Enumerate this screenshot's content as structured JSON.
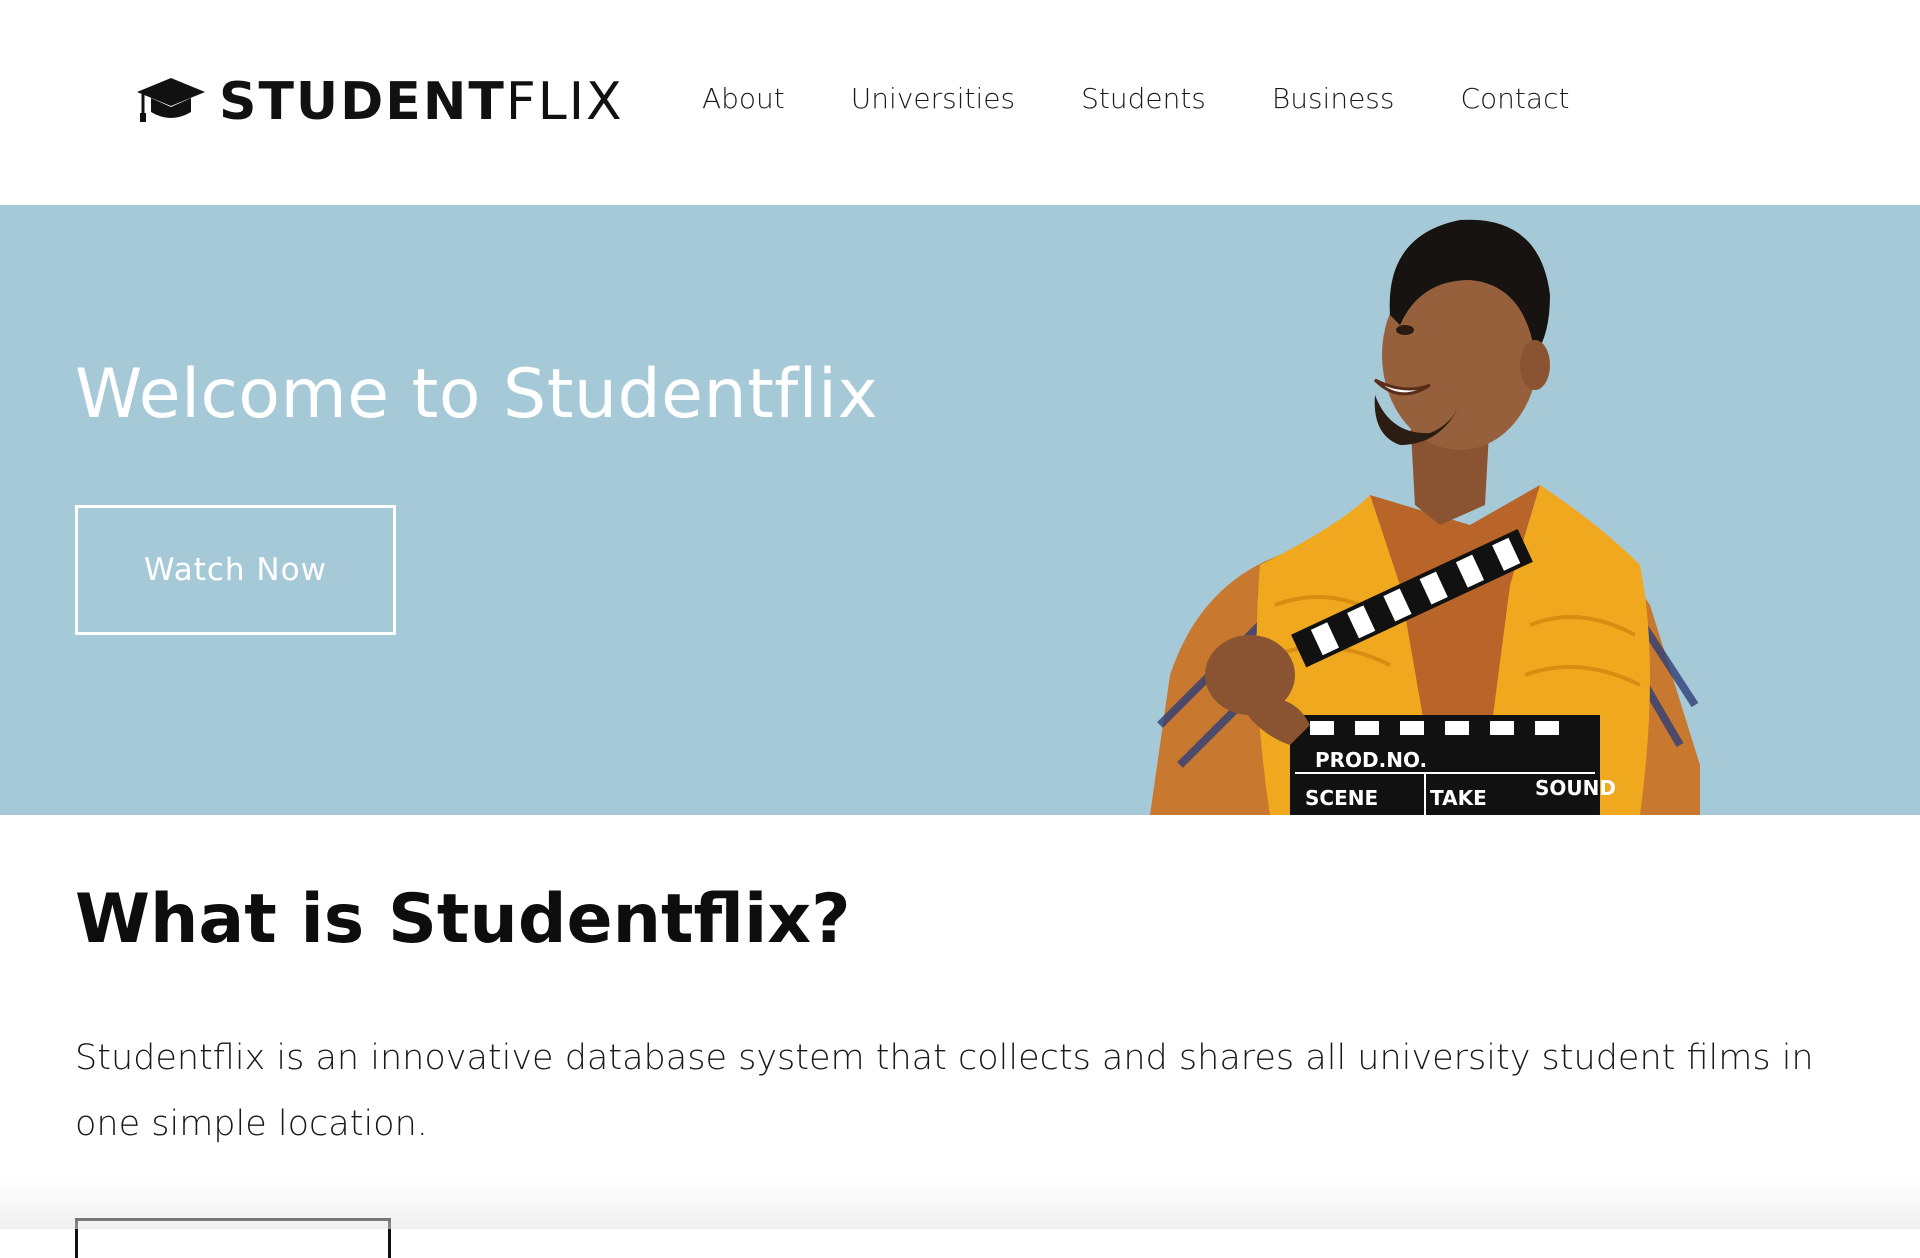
{
  "header": {
    "logo_bold": "STUDENT",
    "logo_light": "FLIX",
    "logo_icon": "graduation-cap-icon",
    "nav": [
      {
        "label": "About"
      },
      {
        "label": "Universities"
      },
      {
        "label": "Students"
      },
      {
        "label": "Business"
      },
      {
        "label": "Contact"
      }
    ]
  },
  "hero": {
    "title": "Welcome to Studentflix",
    "button_label": "Watch Now",
    "background_color": "#a6c9d8",
    "clapperboard": {
      "prod_no": "PROD.NO.",
      "scene": "SCENE",
      "take": "TAKE",
      "sound": "SOUND"
    }
  },
  "about": {
    "title": "What is Studentflix?",
    "body": "Studentflix is an innovative database system that collects and shares all university student films in one simple location."
  }
}
